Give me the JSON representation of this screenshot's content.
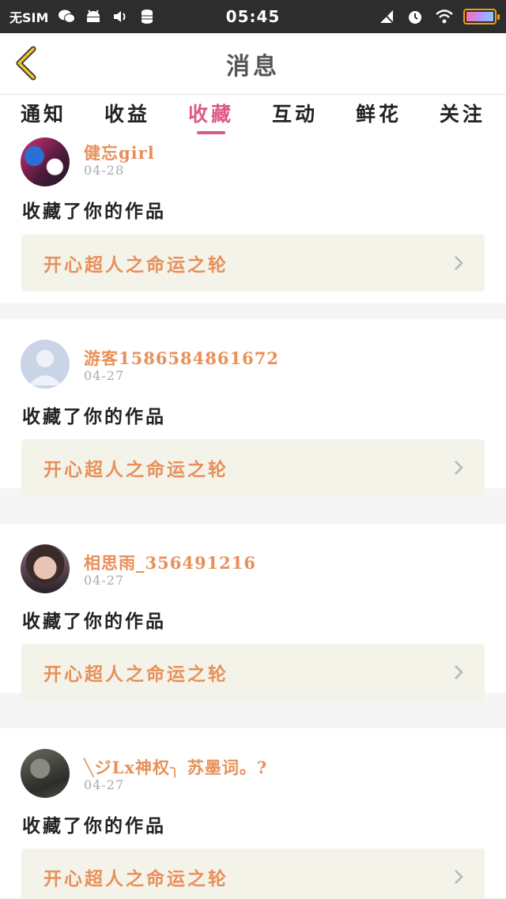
{
  "status_bar": {
    "carrier": "无SIM",
    "time": "05:45"
  },
  "header": {
    "title": "消息"
  },
  "tabs": [
    {
      "label": "通知"
    },
    {
      "label": "收益"
    },
    {
      "label": "收藏"
    },
    {
      "label": "互动"
    },
    {
      "label": "鲜花"
    },
    {
      "label": "关注"
    }
  ],
  "active_tab": "收藏",
  "messages": [
    {
      "user": "健忘girl",
      "date": "04-28",
      "action": "收藏了你的作品",
      "work_title": "开心超人之命运之轮",
      "avatar_icon": "user-avatar"
    },
    {
      "user": "游客1586584861672",
      "date": "04-27",
      "action": "收藏了你的作品",
      "work_title": "开心超人之命运之轮",
      "avatar_icon": "default-avatar"
    },
    {
      "user": "相思雨_356491216",
      "date": "04-27",
      "action": "收藏了你的作品",
      "work_title": "开心超人之命运之轮",
      "avatar_icon": "user-avatar"
    },
    {
      "user": "╲ジLx神权╮ 苏墨词。?",
      "date": "04-27",
      "action": "收藏了你的作品",
      "work_title": "开心超人之命运之轮",
      "avatar_icon": "user-avatar"
    }
  ],
  "colors": {
    "accent": "#e0578a",
    "username": "#e8905a",
    "status_bar": "#2d2d2d",
    "card_inner": "#f4f3ea"
  }
}
